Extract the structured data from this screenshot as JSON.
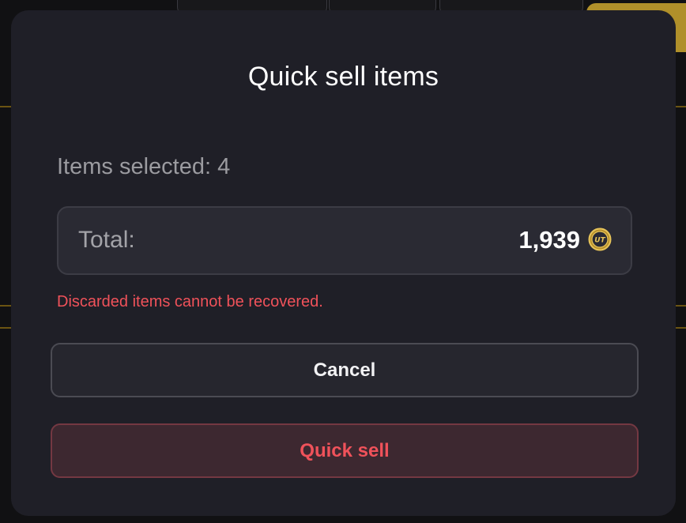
{
  "modal": {
    "title": "Quick sell items",
    "items_selected_label": "Items selected: 4",
    "total": {
      "label": "Total:",
      "value": "1,939",
      "currency_icon": "coin-icon",
      "currency_icon_text": "UT"
    },
    "warning": "Discarded items cannot be recovered.",
    "cancel_label": "Cancel",
    "quick_sell_label": "Quick sell"
  },
  "colors": {
    "modal_background": "#1f1f27",
    "warning_red": "#f0525a",
    "coin_gold": "#d9b54a",
    "backdrop_gold": "#b0902a"
  }
}
